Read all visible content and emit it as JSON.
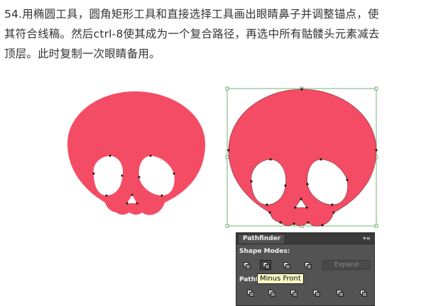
{
  "instructions": {
    "line1": "54.用椭圆工具，圆角矩形工具和直接选择工具画出眼睛鼻子并调整锚点，使",
    "line2": "其符合线稿。然后ctrl-8使其成为一个复合路径，再选中所有骷髅头元素减去",
    "line3": "顶层。此时复制一次眼睛备用。"
  },
  "colors": {
    "skull": "#f44c64",
    "selection": "#4ea04e",
    "panel_bg": "#535353",
    "tooltip_bg": "#fdfec8"
  },
  "pathfinder": {
    "title": "Pathfinder",
    "shape_modes_label": "Shape Modes:",
    "pathfinders_label": "Pathfin",
    "expand_label": "Expand",
    "tooltip": "Minus Front",
    "shape_modes_buttons": [
      "unite-icon",
      "minus-front-icon",
      "intersect-icon",
      "exclude-icon"
    ],
    "pathfinder_buttons": [
      "divide-icon",
      "trim-icon",
      "merge-icon",
      "crop-icon",
      "outline-icon",
      "minus-back-icon"
    ]
  }
}
